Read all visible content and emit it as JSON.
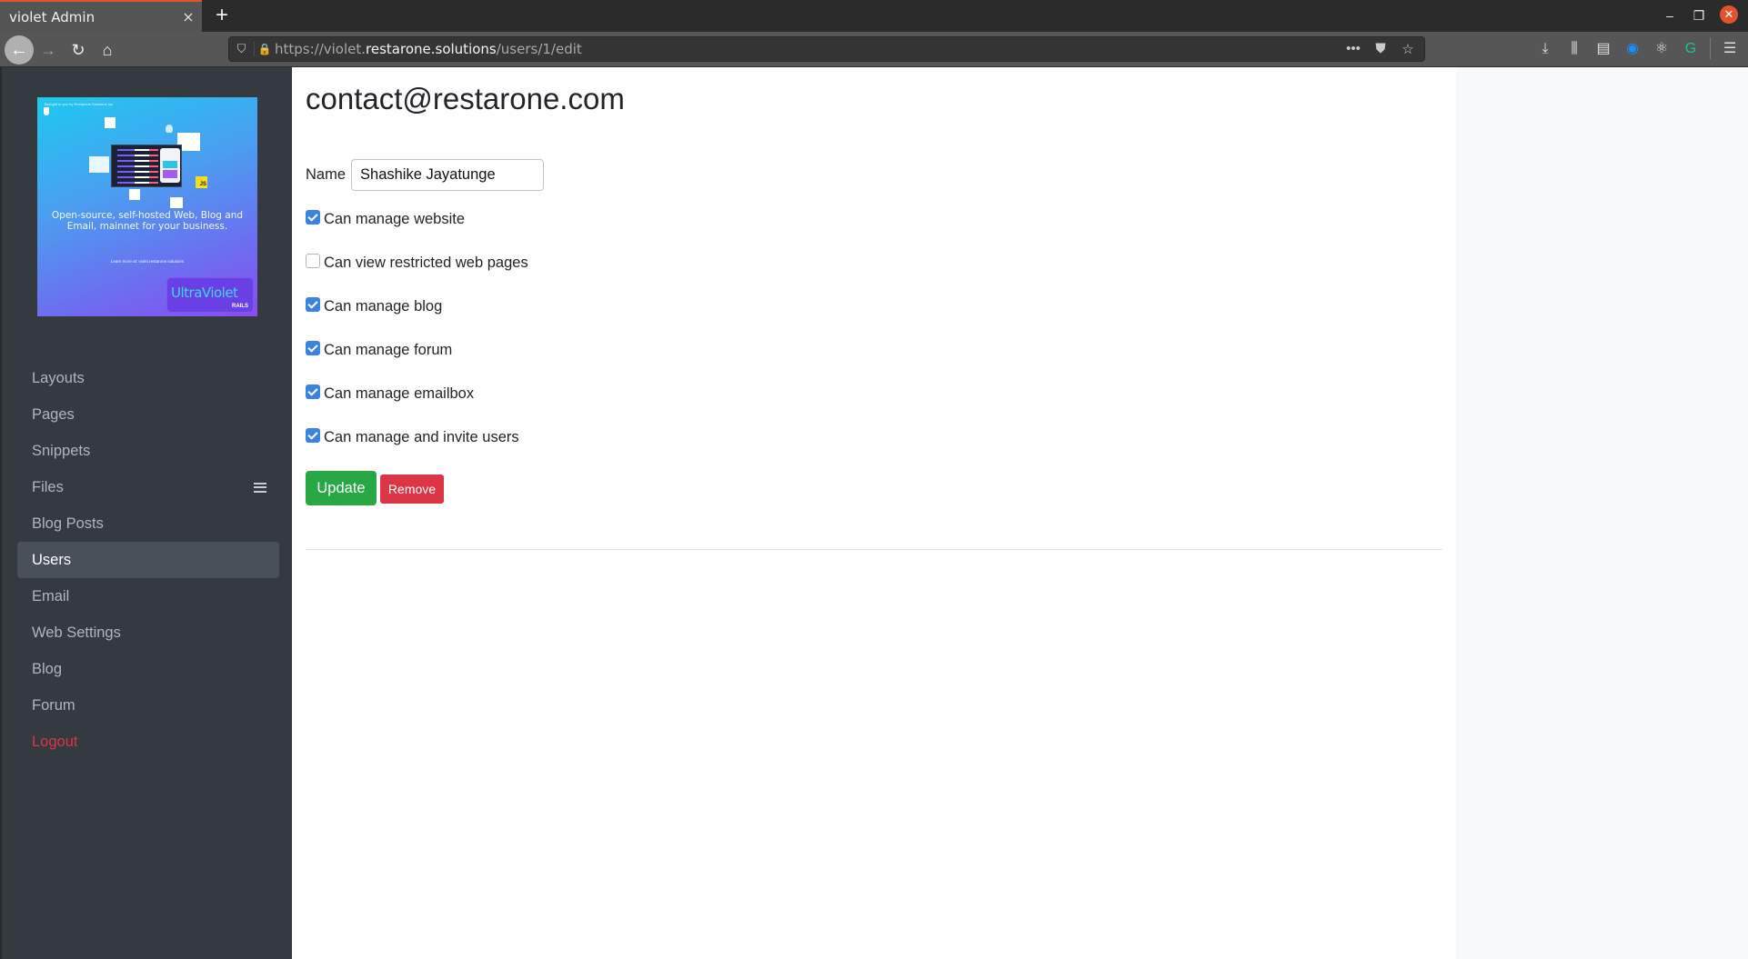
{
  "browser": {
    "tab_title": "violet Admin",
    "tab_close_icon": "×",
    "new_tab_icon": "+",
    "url_prefix": "https://violet.",
    "url_host": "restarone.solutions",
    "url_path": "/users/1/edit",
    "window_controls": {
      "minimize": "–",
      "maximize": "❐",
      "close": "✕"
    },
    "nav": {
      "back": "←",
      "forward": "→",
      "reload": "↻",
      "home": "⌂"
    },
    "url_icons": {
      "shield": "⛉",
      "lock": "🔒",
      "more": "•••",
      "pocket": "⛊",
      "bookmark": "☆"
    },
    "toolbar": {
      "downloads": "⤓",
      "library": "⫼",
      "sidebar": "▤",
      "onepassword": "◉",
      "extension": "⚛",
      "grammarly": "G",
      "menu": "☰"
    }
  },
  "sidebar": {
    "brand": {
      "brought_by": "Brought to you by Restarone Solutions Inc.",
      "tagline": "Open-source, self-hosted Web, Blog and Email, mainnet for your business.",
      "learn_more": "Learn more at: violet.restarone.solutions",
      "badge_main": "UltraViolet",
      "badge_sub": "RAILS",
      "js_label": "JS"
    },
    "items": [
      {
        "label": "Layouts"
      },
      {
        "label": "Pages"
      },
      {
        "label": "Snippets"
      },
      {
        "label": "Files"
      },
      {
        "label": "Blog Posts"
      },
      {
        "label": "Users",
        "active": true
      },
      {
        "label": "Email"
      },
      {
        "label": "Web Settings"
      },
      {
        "label": "Blog"
      },
      {
        "label": "Forum"
      },
      {
        "label": "Logout"
      }
    ]
  },
  "main": {
    "title": "contact@restarone.com",
    "name_label": "Name",
    "name_value": "Shashike Jayatunge",
    "permissions": [
      {
        "label": "Can manage website",
        "checked": true
      },
      {
        "label": "Can view restricted web pages",
        "checked": false
      },
      {
        "label": "Can manage blog",
        "checked": true
      },
      {
        "label": "Can manage forum",
        "checked": true
      },
      {
        "label": "Can manage emailbox",
        "checked": true
      },
      {
        "label": "Can manage and invite users",
        "checked": true
      }
    ],
    "update_label": "Update",
    "remove_label": "Remove"
  },
  "colors": {
    "sidebar_bg": "#343a40",
    "active_item_bg": "#495057",
    "logout": "#dc3545",
    "update_button": "#28a745",
    "remove_button": "#dc3545",
    "checkbox_checked": "#3a83e0"
  }
}
